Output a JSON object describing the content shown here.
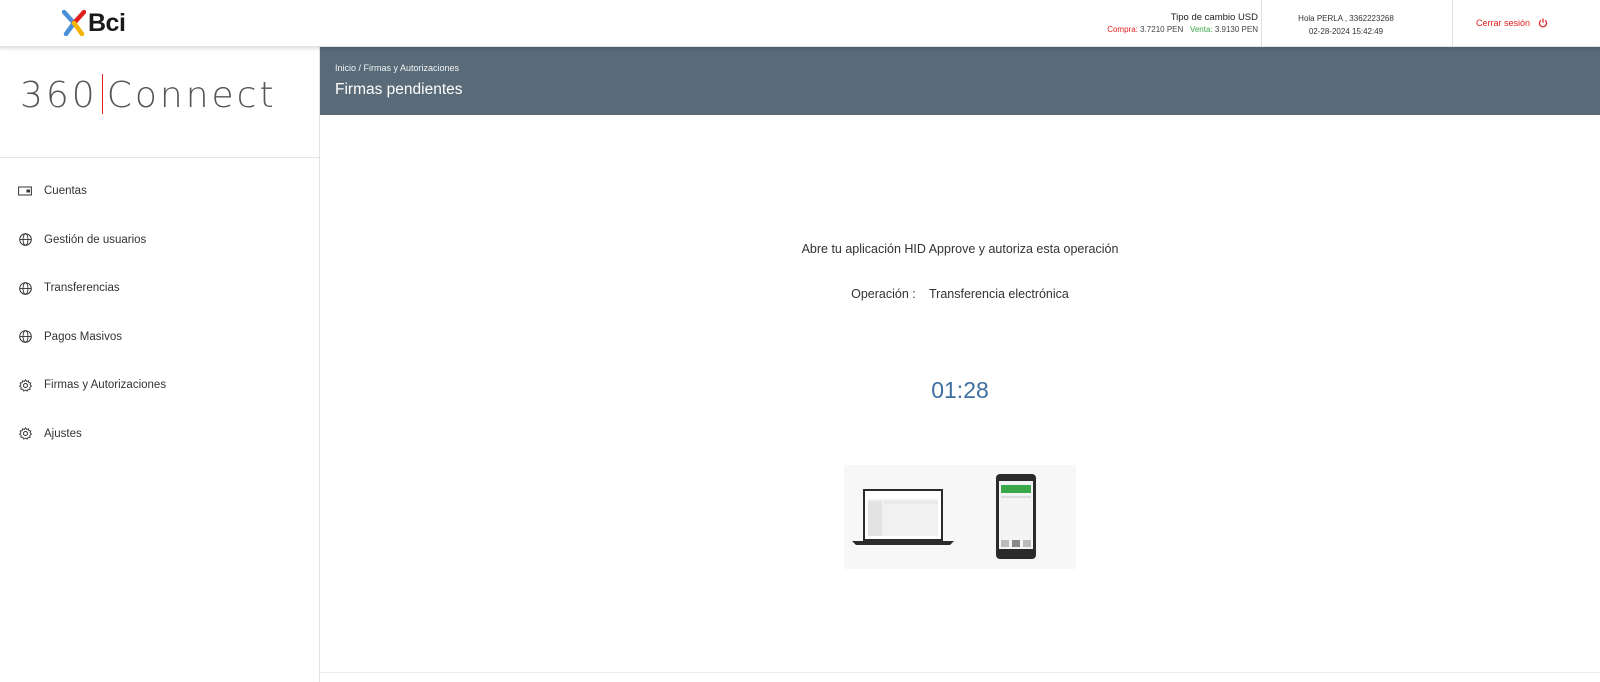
{
  "topbar": {
    "logo_text": "Bci",
    "fx_title": "Tipo de cambio USD",
    "buy_label": "Compra:",
    "buy_value": "3.7210 PEN",
    "sell_label": "Venta:",
    "sell_value": "3.9130 PEN",
    "greeting": "Hola PERLA , 3362223268",
    "datetime": "02-28-2024 15:42:49",
    "logout_label": "Cerrar sesión"
  },
  "sidebar": {
    "brand_left": "360",
    "brand_right": "Connect",
    "items": [
      {
        "label": "Cuentas",
        "icon": "card-icon"
      },
      {
        "label": "Gestión de usuarios",
        "icon": "globe-icon"
      },
      {
        "label": "Transferencias",
        "icon": "globe-icon"
      },
      {
        "label": "Pagos Masivos",
        "icon": "globe-icon"
      },
      {
        "label": "Firmas y Autorizaciones",
        "icon": "gear-icon"
      },
      {
        "label": "Ajustes",
        "icon": "gear-icon"
      }
    ]
  },
  "header": {
    "breadcrumb": "Inicio / Firmas y Autorizaciones",
    "title": "Firmas pendientes"
  },
  "main": {
    "instruction": "Abre tu aplicación HID Approve y autoriza esta operación",
    "operation_label": "Operación :",
    "operation_value": "Transferencia electrónica",
    "timer": "01:28"
  },
  "colors": {
    "header_band": "#596b78",
    "accent_red": "#e0211f",
    "accent_green": "#3aa84a",
    "timer_blue": "#3f6fa0"
  }
}
